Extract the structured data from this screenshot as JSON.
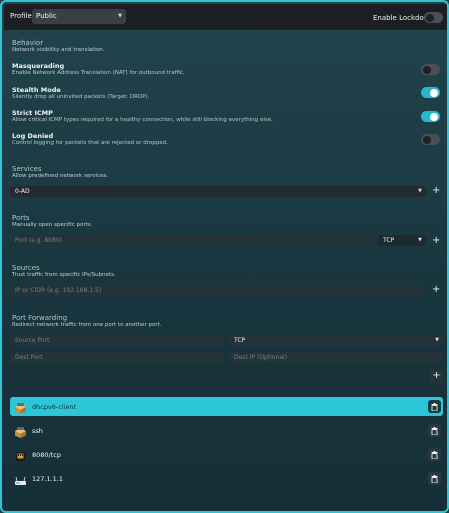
{
  "header": {
    "profile_label": "Profile",
    "profile_value": "Public",
    "lockdown_label": "Enable Lockdown",
    "lockdown_on": false
  },
  "behavior": {
    "title": "Behavior",
    "description": "Network visibility and translation.",
    "options": [
      {
        "title": "Masquerading",
        "description": "Enable Network Address Translation (NAT) for outbound traffic.",
        "enabled": false
      },
      {
        "title": "Stealth Mode",
        "description": "Silently drop all uninvited packets (Target: DROP).",
        "enabled": true
      },
      {
        "title": "Strict ICMP",
        "description": "Allow critical ICMP types required for a healthy connection, while still blocking everything else.",
        "enabled": true
      },
      {
        "title": "Log Denied",
        "description": "Control logging for packets that are rejected or dropped.",
        "enabled": false
      }
    ]
  },
  "services": {
    "title": "Services",
    "description": "Allow predefined network services.",
    "selected": "0-AD"
  },
  "ports": {
    "title": "Ports",
    "description": "Manually open specific ports.",
    "port_placeholder": "Port (e.g. 8080)",
    "protocol": "TCP"
  },
  "sources": {
    "title": "Sources",
    "description": "Trust traffic from specific IPs/Subnets.",
    "placeholder": "IP or CIDR (e.g. 192.168.1.5)"
  },
  "forwarding": {
    "title": "Port Forwarding",
    "description": "Redirect network traffic from one port to another port.",
    "source_port_placeholder": "Source Port",
    "protocol": "TCP",
    "dest_port_placeholder": "Dest Port",
    "dest_ip_placeholder": "Dest IP (Optional)"
  },
  "rules": [
    {
      "label": "dhcpv6-client",
      "icon": "service-box-icon",
      "selected": true
    },
    {
      "label": "ssh",
      "icon": "service-box-icon",
      "selected": false
    },
    {
      "label": "8080/tcp",
      "icon": "port-plug-icon",
      "selected": false
    },
    {
      "label": "127.1.1.1",
      "icon": "router-icon",
      "selected": false
    }
  ],
  "colors": {
    "accent": "#2cc6d9",
    "toggle_on": "#27b8cd",
    "background": "#1c3b44"
  }
}
